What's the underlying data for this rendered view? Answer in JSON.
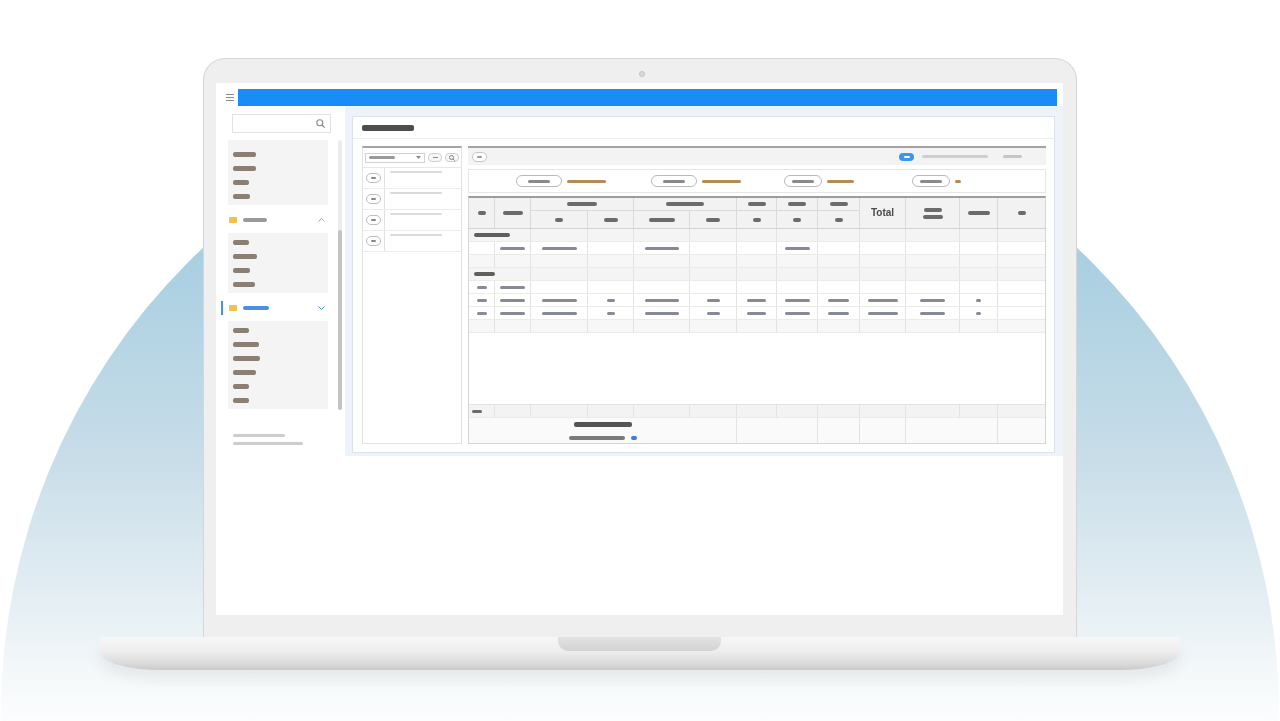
{
  "sidebar": {
    "top_items": [
      {
        "selected": false
      },
      {
        "selected": false
      },
      {
        "selected": false
      },
      {
        "selected": false
      }
    ],
    "groups": [
      {
        "selected": false,
        "items": [
          {
            "selected": false
          },
          {
            "selected": false
          },
          {
            "selected": false
          },
          {
            "selected": false
          }
        ]
      },
      {
        "selected": true,
        "items": [
          {
            "selected": false
          },
          {
            "selected": false
          },
          {
            "selected": false
          },
          {
            "selected": false
          },
          {
            "selected": false
          },
          {
            "selected": false
          }
        ]
      }
    ]
  },
  "list_panel": {
    "items": [
      {
        "selected": false
      },
      {
        "selected": false
      },
      {
        "selected": false
      },
      {
        "selected": false
      }
    ]
  },
  "summary": [
    {
      "selected": false
    },
    {
      "selected": false
    },
    {
      "selected": false
    },
    {
      "selected": false
    }
  ],
  "table": {
    "header_top": [
      {
        "kind": "blurred"
      },
      {
        "kind": "blurred"
      },
      {
        "kind": "blurred"
      },
      {
        "kind": "blurred"
      },
      {
        "kind": "blurred"
      },
      {
        "kind": "blurred"
      },
      {
        "kind": "blurred"
      },
      {
        "kind": "label",
        "label": "Total"
      },
      {
        "kind": "twoline"
      },
      {
        "kind": "blurred"
      },
      {
        "kind": "blurred"
      }
    ],
    "header_bottom": [
      {
        "kind": "blurred"
      },
      {
        "kind": "blurred"
      },
      {
        "kind": "blurred"
      },
      {
        "kind": "blurred"
      },
      {
        "kind": "blurred"
      },
      {
        "kind": "blurred"
      },
      {
        "kind": "blurred"
      }
    ],
    "rows": [
      {
        "kind": "section",
        "cells": [
          {
            "kind": "blurred"
          }
        ]
      },
      {
        "kind": "data",
        "cells": [
          {
            "kind": "empty"
          },
          {
            "kind": "blurred"
          },
          {
            "kind": "blurred"
          },
          {
            "kind": "empty"
          },
          {
            "kind": "blurred"
          },
          {
            "kind": "empty"
          },
          {
            "kind": "empty"
          },
          {
            "kind": "blurred"
          },
          {
            "kind": "empty"
          },
          {
            "kind": "empty"
          },
          {
            "kind": "empty"
          },
          {
            "kind": "empty"
          },
          {
            "kind": "empty"
          }
        ]
      },
      {
        "kind": "blank"
      },
      {
        "kind": "section",
        "cells": [
          {
            "kind": "blurred"
          }
        ]
      },
      {
        "kind": "data",
        "cells": [
          {
            "kind": "blurred"
          },
          {
            "kind": "blurred"
          },
          {
            "kind": "empty"
          },
          {
            "kind": "empty"
          },
          {
            "kind": "empty"
          },
          {
            "kind": "empty"
          },
          {
            "kind": "empty"
          },
          {
            "kind": "empty"
          },
          {
            "kind": "empty"
          },
          {
            "kind": "empty"
          },
          {
            "kind": "empty"
          },
          {
            "kind": "empty"
          },
          {
            "kind": "empty"
          }
        ]
      },
      {
        "kind": "data",
        "cells": [
          {
            "kind": "blurred"
          },
          {
            "kind": "blurred"
          },
          {
            "kind": "blurred"
          },
          {
            "kind": "blurred"
          },
          {
            "kind": "blurred"
          },
          {
            "kind": "blurred"
          },
          {
            "kind": "blurred"
          },
          {
            "kind": "blurred"
          },
          {
            "kind": "blurred"
          },
          {
            "kind": "blurred"
          },
          {
            "kind": "blurred"
          },
          {
            "kind": "blurred"
          },
          {
            "kind": "empty"
          }
        ]
      },
      {
        "kind": "data",
        "cells": [
          {
            "kind": "blurred"
          },
          {
            "kind": "blurred"
          },
          {
            "kind": "blurred"
          },
          {
            "kind": "blurred"
          },
          {
            "kind": "blurred"
          },
          {
            "kind": "blurred"
          },
          {
            "kind": "blurred"
          },
          {
            "kind": "blurred"
          },
          {
            "kind": "blurred"
          },
          {
            "kind": "blurred"
          },
          {
            "kind": "blurred"
          },
          {
            "kind": "blurred"
          },
          {
            "kind": "empty"
          }
        ]
      },
      {
        "kind": "blank"
      }
    ],
    "total_row": {
      "cells": [
        {
          "kind": "blurred"
        }
      ]
    },
    "footer": {
      "lines": [
        {
          "kind": "bold"
        },
        {
          "kind": "linked"
        }
      ]
    }
  }
}
